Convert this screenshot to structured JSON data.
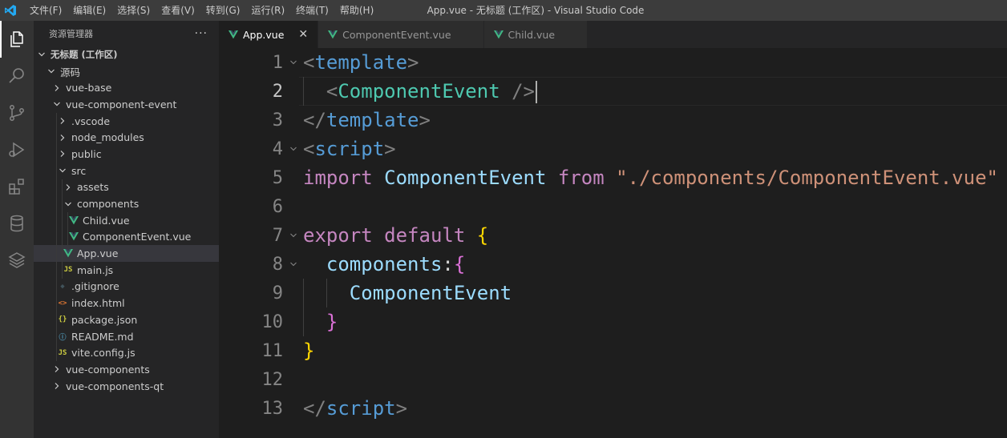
{
  "titlebar": {
    "menu": [
      "文件(F)",
      "编辑(E)",
      "选择(S)",
      "查看(V)",
      "转到(G)",
      "运行(R)",
      "终端(T)",
      "帮助(H)"
    ],
    "window_title": "App.vue - 无标题 (工作区) - Visual Studio Code"
  },
  "activitybar": {
    "icons": [
      "explorer-icon",
      "search-icon",
      "source-control-icon",
      "run-debug-icon",
      "extensions-icon",
      "database-icon",
      "layers-icon"
    ]
  },
  "sidebar": {
    "title": "资源管理器",
    "more": "···",
    "workspace": "无标题 (工作区)",
    "root": "源码",
    "items": [
      {
        "label": "vue-base",
        "type": "folder",
        "open": false,
        "depth": 2
      },
      {
        "label": "vue-component-event",
        "type": "folder",
        "open": true,
        "depth": 2
      },
      {
        "label": ".vscode",
        "type": "folder",
        "open": false,
        "depth": 3
      },
      {
        "label": "node_modules",
        "type": "folder",
        "open": false,
        "depth": 3
      },
      {
        "label": "public",
        "type": "folder",
        "open": false,
        "depth": 3
      },
      {
        "label": "src",
        "type": "folder",
        "open": true,
        "depth": 3
      },
      {
        "label": "assets",
        "type": "folder",
        "open": false,
        "depth": 4
      },
      {
        "label": "components",
        "type": "folder",
        "open": true,
        "depth": 4
      },
      {
        "label": "Child.vue",
        "type": "vue",
        "depth": 5
      },
      {
        "label": "ComponentEvent.vue",
        "type": "vue",
        "depth": 5
      },
      {
        "label": "App.vue",
        "type": "vue",
        "depth": 4,
        "selected": true
      },
      {
        "label": "main.js",
        "type": "js",
        "depth": 4
      },
      {
        "label": ".gitignore",
        "type": "git",
        "depth": 3
      },
      {
        "label": "index.html",
        "type": "html",
        "depth": 3
      },
      {
        "label": "package.json",
        "type": "json",
        "depth": 3
      },
      {
        "label": "README.md",
        "type": "info",
        "depth": 3
      },
      {
        "label": "vite.config.js",
        "type": "js",
        "depth": 3
      },
      {
        "label": "vue-components",
        "type": "folder",
        "open": false,
        "depth": 2
      },
      {
        "label": "vue-components-qt",
        "type": "folder",
        "open": false,
        "depth": 2
      }
    ],
    "icon_glyphs": {
      "js": "JS",
      "json": "{}",
      "html": "<>",
      "info": "ⓘ",
      "git": "◆"
    }
  },
  "tabs": [
    {
      "label": "App.vue",
      "active": true,
      "close": "✕"
    },
    {
      "label": "ComponentEvent.vue",
      "active": false
    },
    {
      "label": "Child.vue",
      "active": false
    }
  ],
  "editor": {
    "current_line": 2,
    "lines": [
      {
        "n": "1",
        "fold": true,
        "tokens": [
          [
            "t-punc",
            "<"
          ],
          [
            "t-tag",
            "template"
          ],
          [
            "t-punc",
            ">"
          ]
        ]
      },
      {
        "n": "2",
        "tokens": [
          [
            "t-txt",
            "  "
          ],
          [
            "t-punc",
            "<"
          ],
          [
            "t-comp",
            "ComponentEvent"
          ],
          [
            "t-txt",
            " "
          ],
          [
            "t-punc",
            "/>"
          ]
        ]
      },
      {
        "n": "3",
        "tokens": [
          [
            "t-punc",
            "</"
          ],
          [
            "t-tag",
            "template"
          ],
          [
            "t-punc",
            ">"
          ]
        ]
      },
      {
        "n": "4",
        "fold": true,
        "tokens": [
          [
            "t-punc",
            "<"
          ],
          [
            "t-tag",
            "script"
          ],
          [
            "t-punc",
            ">"
          ]
        ]
      },
      {
        "n": "5",
        "tokens": [
          [
            "t-kw",
            "import"
          ],
          [
            "t-txt",
            " "
          ],
          [
            "t-var",
            "ComponentEvent"
          ],
          [
            "t-txt",
            " "
          ],
          [
            "t-kw",
            "from"
          ],
          [
            "t-txt",
            " "
          ],
          [
            "t-str",
            "\"./components/ComponentEvent.vue\""
          ]
        ]
      },
      {
        "n": "6",
        "tokens": []
      },
      {
        "n": "7",
        "fold": true,
        "tokens": [
          [
            "t-kw",
            "export"
          ],
          [
            "t-txt",
            " "
          ],
          [
            "t-kw",
            "default"
          ],
          [
            "t-txt",
            " "
          ],
          [
            "t-br1",
            "{"
          ]
        ]
      },
      {
        "n": "8",
        "fold": true,
        "tokens": [
          [
            "t-txt",
            "  "
          ],
          [
            "t-var",
            "components"
          ],
          [
            "t-txt",
            ":"
          ],
          [
            "t-br2",
            "{"
          ]
        ]
      },
      {
        "n": "9",
        "tokens": [
          [
            "t-txt",
            "    "
          ],
          [
            "t-var",
            "ComponentEvent"
          ]
        ]
      },
      {
        "n": "10",
        "tokens": [
          [
            "t-txt",
            "  "
          ],
          [
            "t-br2",
            "}"
          ]
        ]
      },
      {
        "n": "11",
        "tokens": [
          [
            "t-br1",
            "}"
          ]
        ]
      },
      {
        "n": "12",
        "tokens": []
      },
      {
        "n": "13",
        "tokens": [
          [
            "t-punc",
            "</"
          ],
          [
            "t-tag",
            "script"
          ],
          [
            "t-punc",
            ">"
          ]
        ]
      }
    ]
  }
}
